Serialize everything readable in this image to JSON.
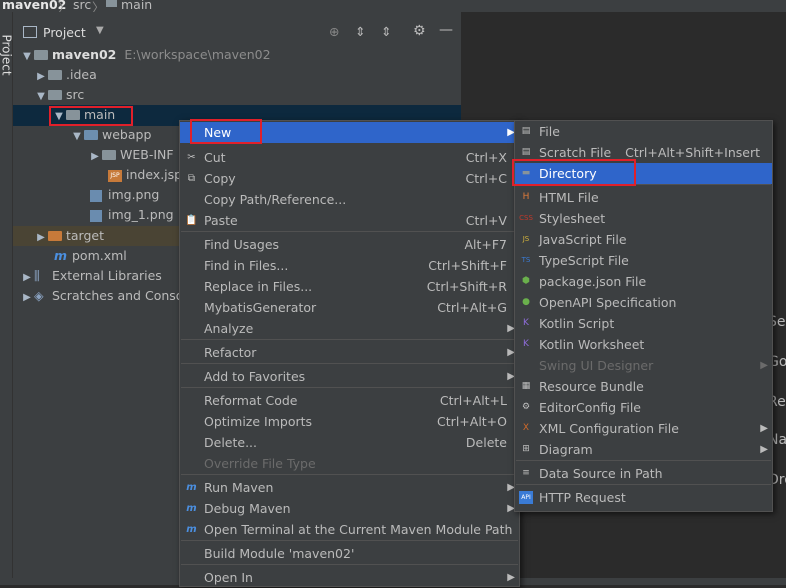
{
  "breadcrumb": {
    "project": "maven02",
    "sep1": "〉",
    "src": "src",
    "sep2": "〉",
    "main": "main"
  },
  "toolstrip": {
    "label": "Project"
  },
  "panel": {
    "title": "Project"
  },
  "tree": {
    "root_name": "maven02",
    "root_path": "E:\\workspace\\maven02",
    "idea": ".idea",
    "src": "src",
    "main": "main",
    "webapp": "webapp",
    "webinf": "WEB-INF",
    "indexjsp": "index.jsp",
    "img": "img.png",
    "img1": "img_1.png",
    "target": "target",
    "pom": "pom.xml",
    "extlib": "External Libraries",
    "scratches": "Scratches and Consol"
  },
  "editor_hints": [
    "Sea",
    "Go",
    "Re",
    "Na",
    "Dro"
  ],
  "context_menu": {
    "items": [
      {
        "label": "New",
        "sc": "",
        "sub": true,
        "sel": true
      },
      {
        "label": "Cut",
        "sc": "Ctrl+X",
        "icon": "✂"
      },
      {
        "label": "Copy",
        "sc": "Ctrl+C",
        "icon": "⧉"
      },
      {
        "label": "Copy Path/Reference...",
        "sc": ""
      },
      {
        "label": "Paste",
        "sc": "Ctrl+V",
        "icon": "📋"
      },
      {
        "label": "Find Usages",
        "sc": "Alt+F7"
      },
      {
        "label": "Find in Files...",
        "sc": "Ctrl+Shift+F"
      },
      {
        "label": "Replace in Files...",
        "sc": "Ctrl+Shift+R"
      },
      {
        "label": "MybatisGenerator",
        "sc": "Ctrl+Alt+G"
      },
      {
        "label": "Analyze",
        "sc": "",
        "sub": true
      },
      {
        "label": "Refactor",
        "sc": "",
        "sub": true
      },
      {
        "label": "Add to Favorites",
        "sc": "",
        "sub": true
      },
      {
        "label": "Reformat Code",
        "sc": "Ctrl+Alt+L"
      },
      {
        "label": "Optimize Imports",
        "sc": "Ctrl+Alt+O"
      },
      {
        "label": "Delete...",
        "sc": "Delete"
      },
      {
        "label": "Override File Type",
        "sc": "",
        "dis": true
      },
      {
        "label": "Run Maven",
        "sc": "",
        "sub": true,
        "icon": "m"
      },
      {
        "label": "Debug Maven",
        "sc": "",
        "sub": true,
        "icon": "m"
      },
      {
        "label": "Open Terminal at the Current Maven Module Path",
        "sc": "",
        "icon": "m"
      },
      {
        "label": "Build Module 'maven02'",
        "sc": ""
      },
      {
        "label": "Open In",
        "sc": "",
        "sub": true
      }
    ]
  },
  "new_menu": {
    "items": [
      {
        "label": "File",
        "sc": "",
        "icon": "▤"
      },
      {
        "label": "Scratch File",
        "sc": "Ctrl+Alt+Shift+Insert",
        "icon": "▤"
      },
      {
        "label": "Directory",
        "sc": "",
        "sel": true,
        "icon": "▬"
      },
      {
        "label": "HTML File",
        "sc": "",
        "icon": "H"
      },
      {
        "label": "Stylesheet",
        "sc": "",
        "icon": "CSS"
      },
      {
        "label": "JavaScript File",
        "sc": "",
        "icon": "JS"
      },
      {
        "label": "TypeScript File",
        "sc": "",
        "icon": "TS"
      },
      {
        "label": "package.json File",
        "sc": "",
        "icon": "⬢"
      },
      {
        "label": "OpenAPI Specification",
        "sc": "",
        "icon": "●"
      },
      {
        "label": "Kotlin Script",
        "sc": "",
        "icon": "K"
      },
      {
        "label": "Kotlin Worksheet",
        "sc": "",
        "icon": "K"
      },
      {
        "label": "Swing UI Designer",
        "sc": "",
        "sub": true,
        "dis": true
      },
      {
        "label": "Resource Bundle",
        "sc": "",
        "icon": "▦"
      },
      {
        "label": "EditorConfig File",
        "sc": "",
        "icon": "⚙"
      },
      {
        "label": "XML Configuration File",
        "sc": "",
        "sub": true,
        "icon": "X"
      },
      {
        "label": "Diagram",
        "sc": "",
        "sub": true,
        "icon": "⊞"
      },
      {
        "label": "Data Source in Path",
        "sc": "",
        "icon": "≡"
      },
      {
        "label": "HTTP Request",
        "sc": "",
        "icon": "API"
      }
    ]
  },
  "colors": {
    "selection": "#2f65ca",
    "highlight": "#e0202a",
    "panel": "#3c3f41",
    "editor": "#2b2b2b"
  }
}
